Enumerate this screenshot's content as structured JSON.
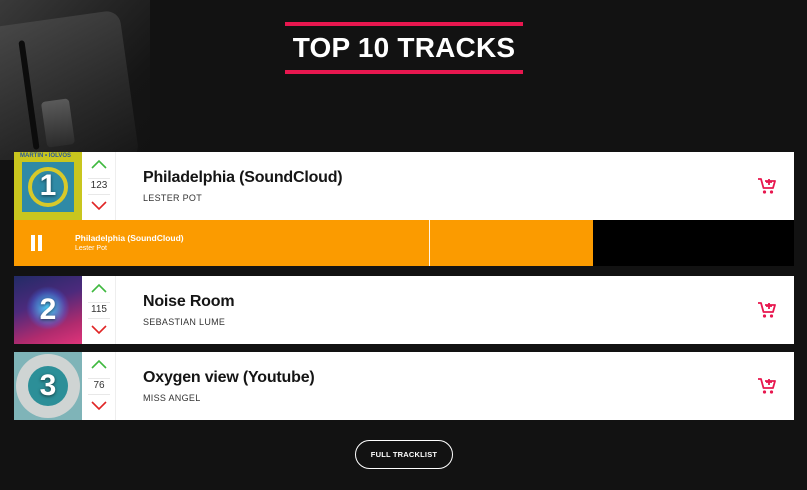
{
  "header": {
    "title": "TOP 10 TRACKS"
  },
  "colors": {
    "accent": "#e8174f",
    "player": "#fb9b00",
    "upvote": "#3fb93f",
    "downvote": "#e02525"
  },
  "tracks": [
    {
      "rank": "1",
      "title": "Philadelphia (SoundCloud)",
      "artist": "LESTER POT",
      "votes": "123",
      "cover_text": "MARTIN • IOLVOS",
      "icon": "cart-add-icon"
    },
    {
      "rank": "2",
      "title": "Noise Room",
      "artist": "SEBASTIAN LUME",
      "votes": "115",
      "icon": "cart-add-icon"
    },
    {
      "rank": "3",
      "title": "Oxygen view (Youtube)",
      "artist": "MISS ANGEL",
      "votes": "76",
      "icon": "cart-add-icon"
    }
  ],
  "player": {
    "title": "Philadelphia (SoundCloud)",
    "artist": "Lester Pot",
    "buffered_fraction": 0.742,
    "played_fraction": 0.532,
    "state": "playing",
    "icon": "pause-icon"
  },
  "footer": {
    "button_label": "FULL TRACKLIST"
  }
}
